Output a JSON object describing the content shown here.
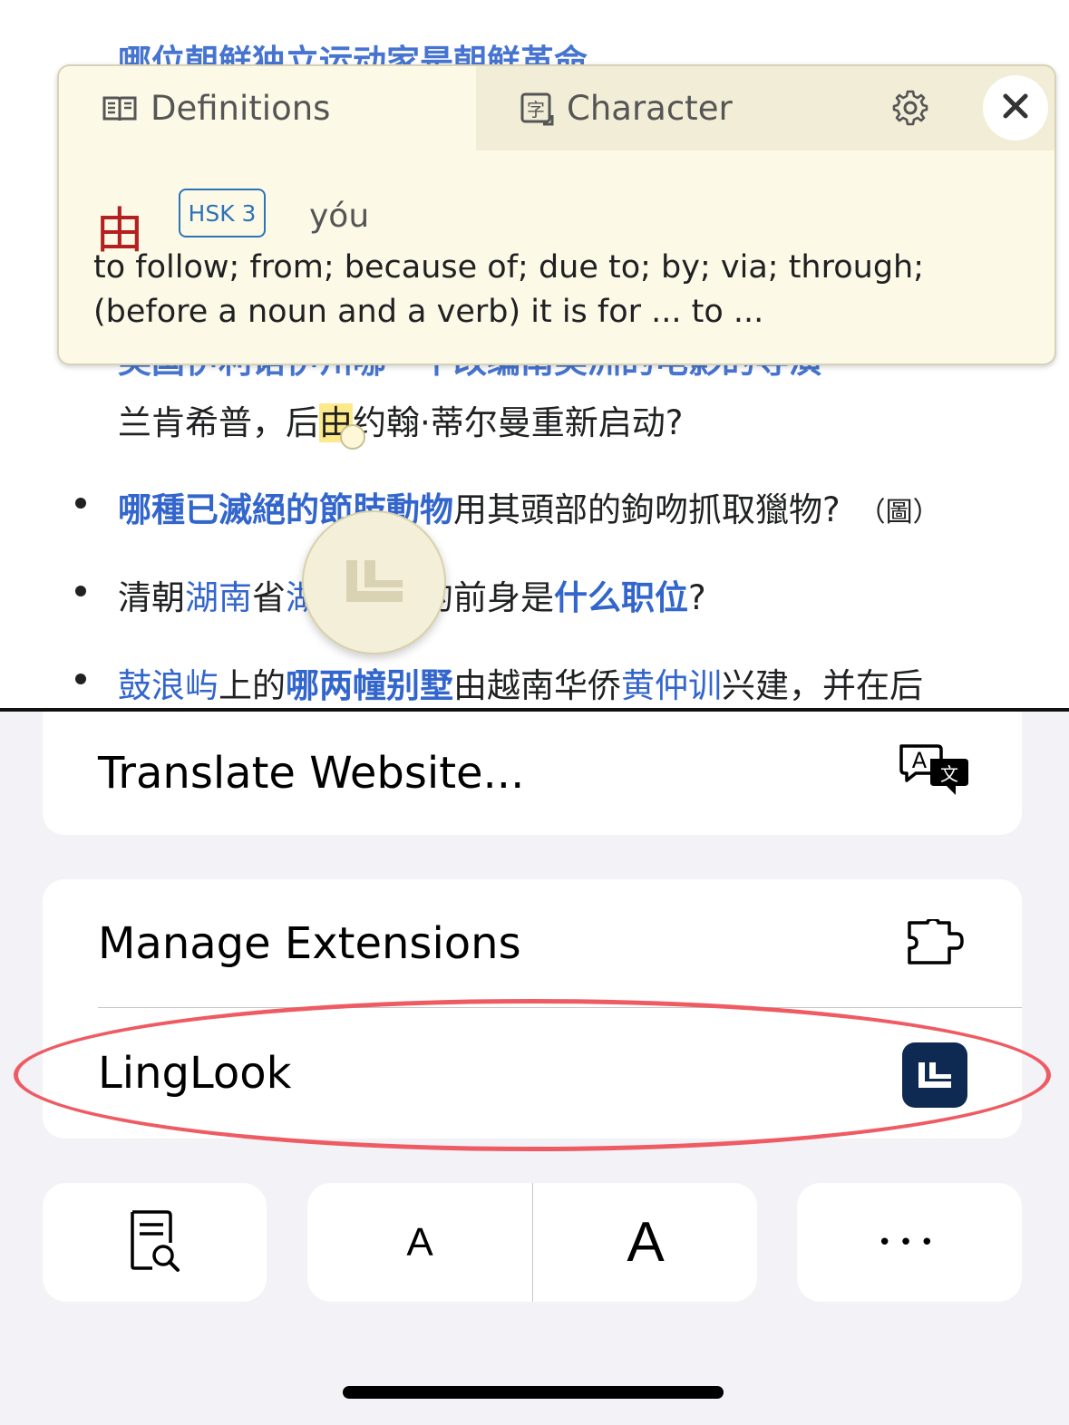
{
  "webpage": {
    "partial_top": "哪位朝鲜独立运动家是朝鲜革命",
    "partial_hidden": "美国伊利诺伊州哪一个改编南美洲的电影的导演",
    "line1": {
      "a": "兰肯希普，后",
      "hl": "由",
      "b": "约翰·蒂尔曼重新启动?"
    },
    "item2": {
      "link_bold": "哪種已滅絕的節肢動物",
      "text": "用其頭部的鉤吻抓取獵物?",
      "note": "（圖）"
    },
    "item3": {
      "a": "清朝",
      "link1": "湖南",
      "b": "省",
      "link2": "湖南巡抚",
      "c": "的前身是",
      "link_bold": "什么职位",
      "d": "?"
    },
    "item4": {
      "link1": "鼓浪屿",
      "a": "上的",
      "link_bold": "哪两幢别墅",
      "b": "由越南华侨",
      "link2": "黄仲训",
      "c": "兴建，并在后"
    }
  },
  "popup": {
    "tab_definitions": "Definitions",
    "tab_character": "Character",
    "hanzi": "由",
    "hsk_badge": "HSK 3",
    "pinyin": "yóu",
    "definition": "to follow; from; because of; due to; by; via; through; (before a noun and a verb) it is for ... to ..."
  },
  "menu": {
    "translate_label": "Translate Website...",
    "manage_extensions_label": "Manage Extensions",
    "linglook_label": "LingLook"
  },
  "toolbar": {
    "font_small": "A",
    "font_large": "A",
    "more": "•••"
  },
  "colors": {
    "link": "#3366cc",
    "highlight": "#fbe98a",
    "popup_bg": "#fdf9e7",
    "hanzi": "#b3201f",
    "hsk": "#2d73b7",
    "oval": "#ee5b63",
    "linglook_icon_bg": "#0f2a52"
  }
}
